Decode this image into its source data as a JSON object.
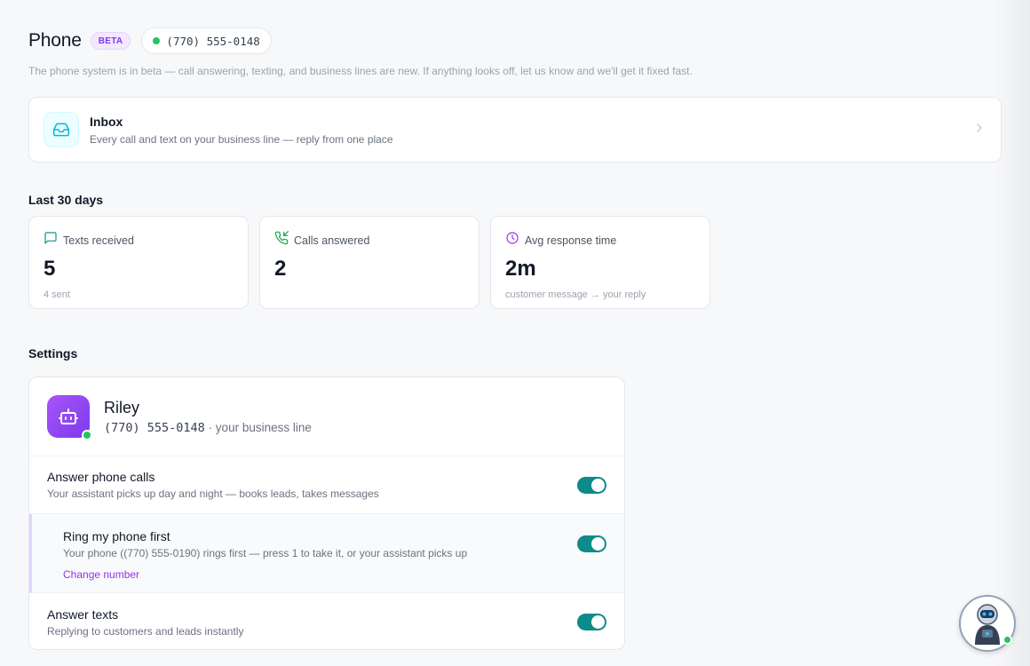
{
  "header": {
    "title": "Phone",
    "badge": "BETA",
    "business_number": "(770) 555-0148",
    "beta_note": "The phone system is in beta — call answering, texting, and business lines are new. If anything looks off, let us know and we'll get it fixed fast."
  },
  "inbox": {
    "title": "Inbox",
    "subtitle": "Every call and text on your business line — reply from one place",
    "icon": "inbox-icon"
  },
  "stats": {
    "section_title": "Last 30 days",
    "cards": [
      {
        "label": "Texts received",
        "value": "5",
        "sub": "4 sent",
        "icon": "message-icon"
      },
      {
        "label": "Calls answered",
        "value": "2",
        "sub": "",
        "icon": "phone-incoming-icon"
      },
      {
        "label": "Avg response time",
        "value": "2m",
        "sub": "customer message → your reply",
        "icon": "clock-icon"
      }
    ]
  },
  "settings": {
    "section_title": "Settings",
    "assistant": {
      "name": "Riley",
      "number": "(770) 555-0148",
      "line_suffix": "· your business line"
    },
    "rows": [
      {
        "title": "Answer phone calls",
        "sub": "Your assistant picks up day and night — books leads, takes messages",
        "enabled": true
      },
      {
        "title": "Ring my phone first",
        "sub": "Your phone ((770) 555-0190) rings first — press 1 to take it, or your assistant picks up",
        "link": "Change number",
        "enabled": true
      },
      {
        "title": "Answer texts",
        "sub": "Replying to customers and leads instantly",
        "enabled": true
      }
    ]
  },
  "colors": {
    "accent_purple": "#7c3aed",
    "toggle_on": "#0d8a8a",
    "online_green": "#22c55e",
    "inbox_teal": "#06b6d4"
  }
}
